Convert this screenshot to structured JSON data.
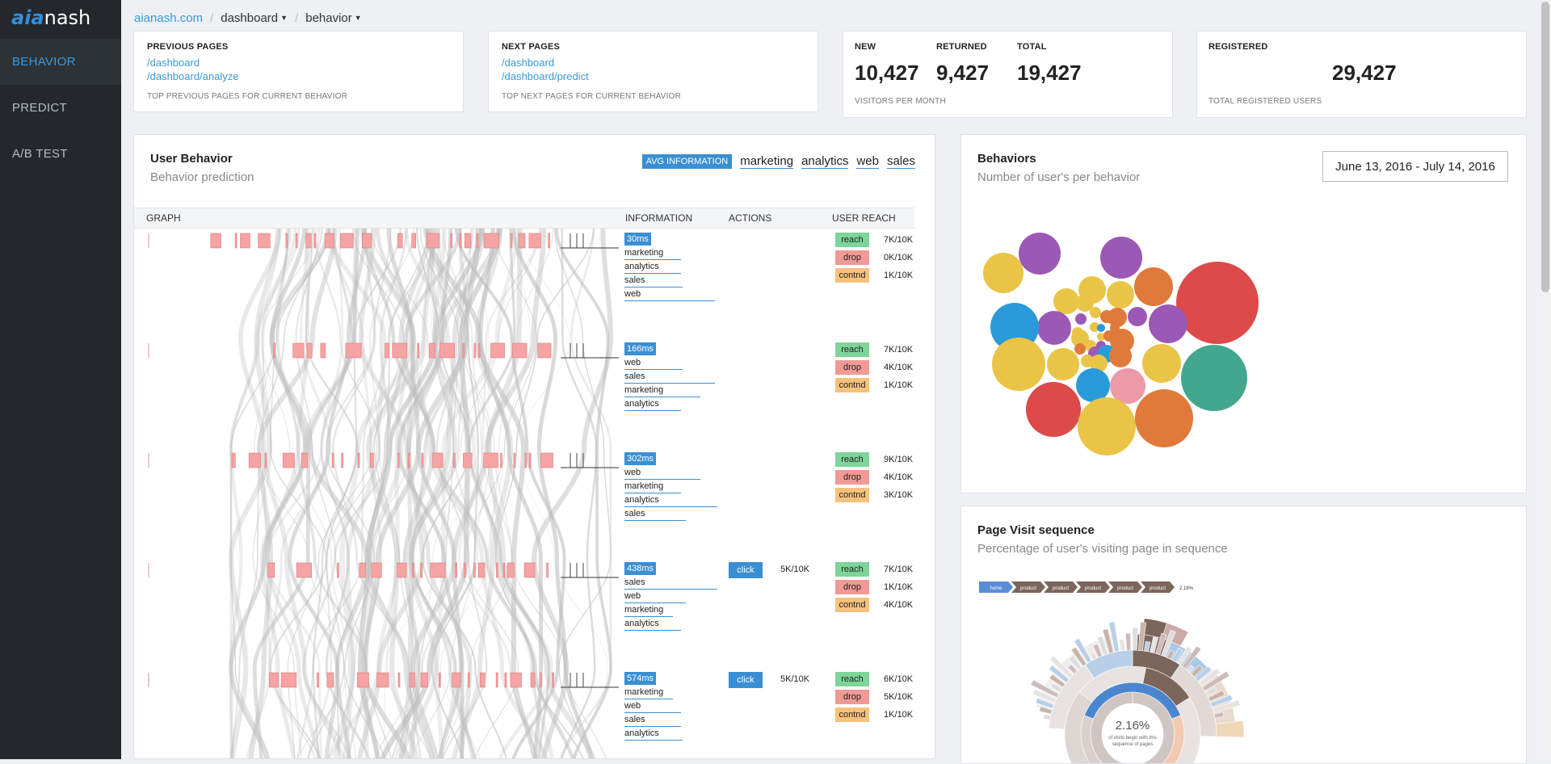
{
  "brand": {
    "logo_prefix": "aia",
    "logo_suffix": "nash"
  },
  "sidebar": {
    "items": [
      {
        "label": "BEHAVIOR",
        "active": true
      },
      {
        "label": "PREDICT"
      },
      {
        "label": "A/B TEST"
      }
    ]
  },
  "breadcrumb": {
    "site": "aianash.com",
    "section": "dashboard",
    "page": "behavior"
  },
  "cards": {
    "previous": {
      "title": "PREVIOUS PAGES",
      "links": [
        "/dashboard",
        "/dashboard/analyze"
      ],
      "footer": "TOP PREVIOUS PAGES FOR CURRENT BEHAVIOR"
    },
    "next": {
      "title": "NEXT PAGES",
      "links": [
        "/dashboard",
        "/dashboard/predict"
      ],
      "footer": "TOP NEXT PAGES FOR CURRENT BEHAVIOR"
    },
    "visitors": {
      "new_label": "NEW",
      "new_value": "10,427",
      "returned_label": "RETURNED",
      "returned_value": "9,427",
      "total_label": "TOTAL",
      "total_value": "19,427",
      "footer": "VISITORS PER MONTH"
    },
    "registered": {
      "title": "REGISTERED",
      "value": "29,427",
      "footer": "TOTAL REGISTERED USERS"
    }
  },
  "user_behavior": {
    "title": "User Behavior",
    "subtitle": "Behavior prediction",
    "avg_button": "AVG INFORMATION",
    "filters": [
      "marketing",
      "analytics",
      "web",
      "sales"
    ],
    "columns": {
      "graph": "GRAPH",
      "information": "INFORMATION",
      "actions": "ACTIONS",
      "reach": "USER REACH"
    },
    "reach_labels": {
      "reach": "reach",
      "drop": "drop",
      "contnd": "contnd"
    },
    "rows": [
      {
        "time": "30ms",
        "pages": [
          "marketing",
          "analytics",
          "sales",
          "web"
        ],
        "action": null,
        "reach": "7K/10K",
        "drop": "0K/10K",
        "contnd": "1K/10K"
      },
      {
        "time": "166ms",
        "pages": [
          "web",
          "sales",
          "marketing",
          "analytics"
        ],
        "action": null,
        "reach": "7K/10K",
        "drop": "4K/10K",
        "contnd": "1K/10K"
      },
      {
        "time": "302ms",
        "pages": [
          "web",
          "marketing",
          "analytics",
          "sales"
        ],
        "action": null,
        "reach": "9K/10K",
        "drop": "4K/10K",
        "contnd": "3K/10K"
      },
      {
        "time": "438ms",
        "pages": [
          "sales",
          "web",
          "marketing",
          "analytics"
        ],
        "action": {
          "label": "click",
          "count": "5K/10K"
        },
        "reach": "7K/10K",
        "drop": "1K/10K",
        "contnd": "4K/10K"
      },
      {
        "time": "574ms",
        "pages": [
          "marketing",
          "web",
          "sales",
          "analytics"
        ],
        "action": {
          "label": "click",
          "count": "5K/10K"
        },
        "reach": "6K/10K",
        "drop": "5K/10K",
        "contnd": "1K/10K"
      }
    ]
  },
  "behaviors": {
    "title": "Behaviors",
    "subtitle": "Number of user's per behavior",
    "date_range": "June 13, 2016 - July 14, 2016"
  },
  "page_visit": {
    "title": "Page Visit sequence",
    "subtitle": "Percentage of user's visiting page in sequence",
    "sequence": [
      "home",
      "product",
      "product",
      "product",
      "product",
      "product"
    ],
    "sequence_percent": "2.16%",
    "center_percent": "2.16%",
    "center_caption": [
      "of visits begin with this",
      "sequence of pages"
    ]
  },
  "colors": {
    "accent": "#3a8fd3",
    "reach": "#7ed499",
    "drop": "#f09a95",
    "contnd": "#f6c27c",
    "sidebar": "#24282c"
  }
}
